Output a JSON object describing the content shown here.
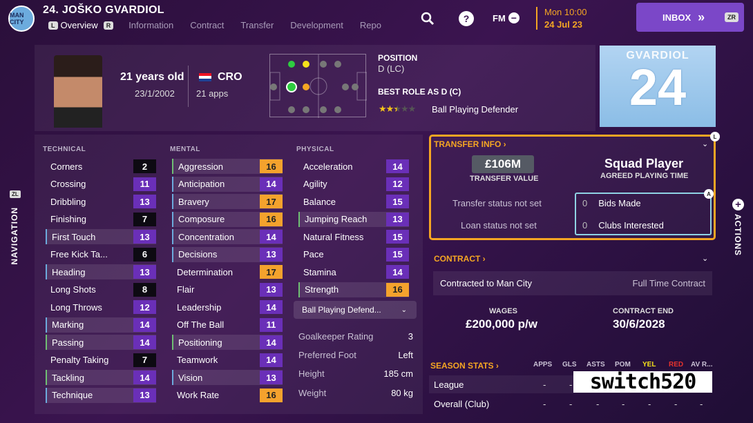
{
  "header": {
    "club_badge": "MAN CITY",
    "player_title": "24. JOŠKO GVARDIOL",
    "key_left": "L",
    "key_right": "R",
    "tabs": [
      "Overview",
      "Information",
      "Contract",
      "Transfer",
      "Development",
      "Repo"
    ],
    "help_label": "?",
    "fm_label": "FM",
    "fm_minus": "−",
    "date_line1": "Mon 10:00",
    "date_line2": "24 Jul 23",
    "inbox_label": "INBOX",
    "inbox_arrows": "»",
    "inbox_key": "ZR"
  },
  "profile": {
    "age": "21 years old",
    "dob": "23/1/2002",
    "nation": "CRO",
    "apps": "21 apps",
    "position_title": "POSITION",
    "position": "D (LC)",
    "best_role_title": "BEST ROLE AS D (C)",
    "role_stars": 2.5,
    "role_name": "Ball Playing Defender",
    "shirt_name": "GVARDIOL",
    "shirt_number": "24"
  },
  "attributes": {
    "technical_title": "TECHNICAL",
    "mental_title": "MENTAL",
    "physical_title": "PHYSICAL",
    "technical": [
      {
        "name": "Corners",
        "value": "2"
      },
      {
        "name": "Crossing",
        "value": "11"
      },
      {
        "name": "Dribbling",
        "value": "13"
      },
      {
        "name": "Finishing",
        "value": "7"
      },
      {
        "name": "First Touch",
        "value": "13"
      },
      {
        "name": "Free Kick Ta...",
        "value": "6"
      },
      {
        "name": "Heading",
        "value": "13"
      },
      {
        "name": "Long Shots",
        "value": "8"
      },
      {
        "name": "Long Throws",
        "value": "12"
      },
      {
        "name": "Marking",
        "value": "14"
      },
      {
        "name": "Passing",
        "value": "14"
      },
      {
        "name": "Penalty Taking",
        "value": "7"
      },
      {
        "name": "Tackling",
        "value": "14"
      },
      {
        "name": "Technique",
        "value": "13"
      }
    ],
    "mental": [
      {
        "name": "Aggression",
        "value": "16"
      },
      {
        "name": "Anticipation",
        "value": "14"
      },
      {
        "name": "Bravery",
        "value": "17"
      },
      {
        "name": "Composure",
        "value": "16"
      },
      {
        "name": "Concentration",
        "value": "14"
      },
      {
        "name": "Decisions",
        "value": "13"
      },
      {
        "name": "Determination",
        "value": "17"
      },
      {
        "name": "Flair",
        "value": "13"
      },
      {
        "name": "Leadership",
        "value": "14"
      },
      {
        "name": "Off The Ball",
        "value": "11"
      },
      {
        "name": "Positioning",
        "value": "14"
      },
      {
        "name": "Teamwork",
        "value": "14"
      },
      {
        "name": "Vision",
        "value": "13"
      },
      {
        "name": "Work Rate",
        "value": "16"
      }
    ],
    "physical": [
      {
        "name": "Acceleration",
        "value": "14"
      },
      {
        "name": "Agility",
        "value": "12"
      },
      {
        "name": "Balance",
        "value": "15"
      },
      {
        "name": "Jumping Reach",
        "value": "13"
      },
      {
        "name": "Natural Fitness",
        "value": "15"
      },
      {
        "name": "Pace",
        "value": "15"
      },
      {
        "name": "Stamina",
        "value": "14"
      },
      {
        "name": "Strength",
        "value": "16"
      }
    ],
    "role_select": "Ball Playing Defend...",
    "role_select_chevron": "⌄",
    "info": [
      {
        "label": "Goalkeeper Rating",
        "value": "3"
      },
      {
        "label": "Preferred Foot",
        "value": "Left"
      },
      {
        "label": "Height",
        "value": "185 cm"
      },
      {
        "label": "Weight",
        "value": "80 kg"
      }
    ]
  },
  "transfer": {
    "title": "TRANSFER INFO ›",
    "value": "£106M",
    "value_label": "TRANSFER VALUE",
    "squad_status": "Squad Player",
    "squad_label": "AGREED PLAYING TIME",
    "transfer_status": "Transfer status not set",
    "loan_status": "Loan status not set",
    "bids_count": "0",
    "bids_label": "Bids Made",
    "clubs_count": "0",
    "clubs_label": "Clubs Interested",
    "badge_l": "L",
    "badge_a": "A"
  },
  "contract": {
    "title": "CONTRACT ›",
    "contracted_to": "Contracted to Man City",
    "type": "Full Time Contract",
    "wages_label": "WAGES",
    "wages": "£200,000 p/w",
    "end_label": "CONTRACT END",
    "end": "30/6/2028"
  },
  "season_stats": {
    "title": "SEASON STATS ›",
    "headers": [
      "APPS",
      "GLS",
      "ASTS",
      "POM",
      "YEL",
      "RED",
      "AV R..."
    ],
    "rows": [
      {
        "label": "League",
        "values": [
          "-",
          "-",
          "-",
          "-",
          "-",
          "-",
          "-"
        ]
      },
      {
        "label": "Overall (Club)",
        "values": [
          "-",
          "-",
          "-",
          "-",
          "-",
          "-",
          "-"
        ]
      }
    ]
  },
  "navigation": {
    "left_label": "NAVIGATION",
    "left_key": "ZL",
    "right_label": "ACTIONS",
    "right_plus": "+"
  },
  "watermark": "switch520",
  "colors": {
    "accent_orange": "#f5a623",
    "value_purple": "#6a2fb8",
    "value_orange": "#f4a22d",
    "value_black": "#0d0a12",
    "inbox_purple": "#7b47c8",
    "highlight_blue": "#8fd3e4",
    "yellow_card": "#f5e11b",
    "red_card": "#e5322c"
  }
}
